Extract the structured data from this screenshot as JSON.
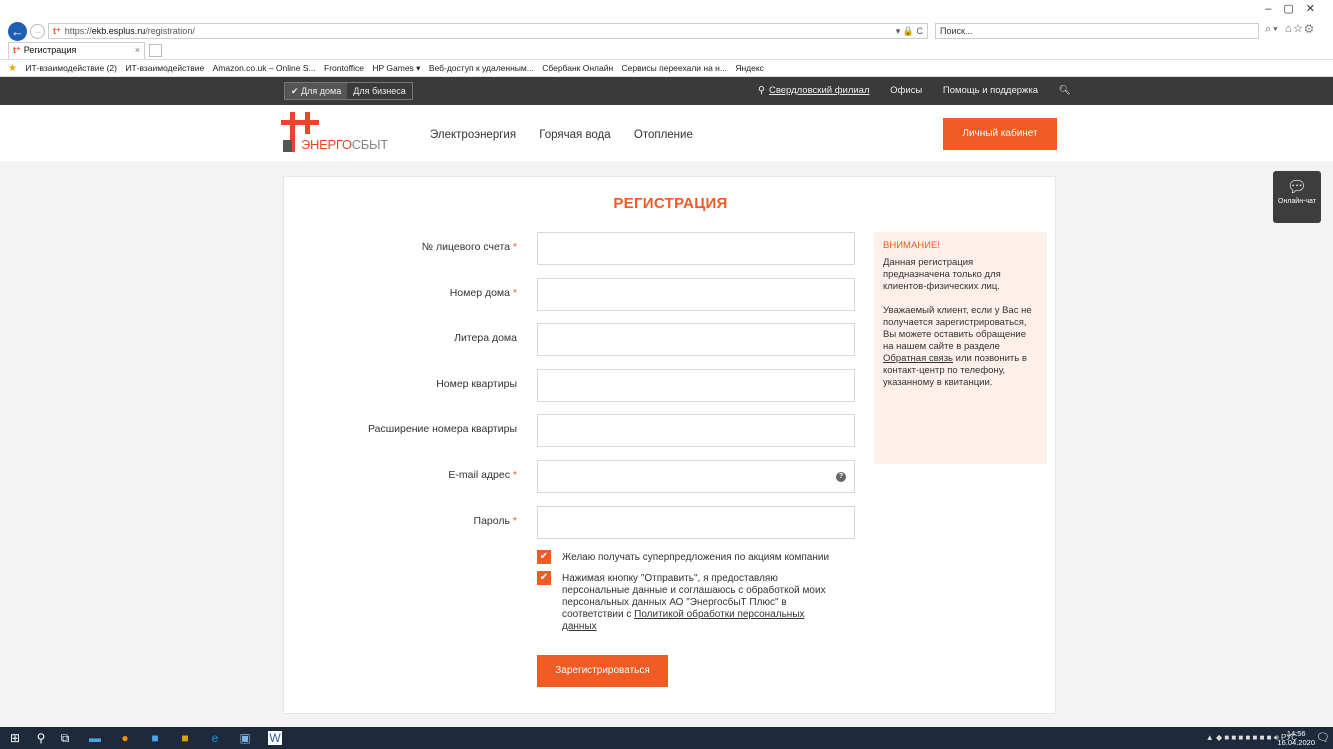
{
  "browser": {
    "url_prefix": "https://",
    "url_host": "ekb.esplus.ru",
    "url_path": "/registration/",
    "url_tools": "▾ 🔒 C",
    "search_placeholder": "Поиск...",
    "tab_title": "Регистрация",
    "favorites": [
      "ИТ-взаимодействие (2)",
      "ИТ-взаимодействие",
      "Amazon.co.uk – Online S...",
      "Frontoffice",
      "HP Games ▾",
      "Веб-доступ к удаленным...",
      "Сбербанк Онлайн",
      "Сервисы переехали на н...",
      "Яндекс"
    ]
  },
  "topstrip": {
    "home_label": "✔ Для дома",
    "business_label": "Для бизнеса",
    "branch": "Свердловский филиал",
    "offices": "Офисы",
    "help": "Помощь и поддержка"
  },
  "header": {
    "logo_brand_a": "ЭНЕРГО",
    "logo_brand_b": "СБЫТ",
    "menu": [
      "Электроэнергия",
      "Горячая вода",
      "Отопление"
    ],
    "cabinet_button": "Личный кабинет"
  },
  "form": {
    "title": "РЕГИСТРАЦИЯ",
    "fields": [
      {
        "label": "№ лицевого счета",
        "required": "*"
      },
      {
        "label": "Номер дома",
        "required": "*"
      },
      {
        "label": "Литера дома",
        "required": ""
      },
      {
        "label": "Номер квартиры",
        "required": ""
      },
      {
        "label": "Расширение номера квартиры",
        "required": ""
      },
      {
        "label": "E-mail адрес",
        "required": "*"
      },
      {
        "label": "Пароль",
        "required": "*"
      }
    ],
    "consent1": "Желаю получать суперпредложения по акциям компании",
    "consent2_text": "Нажимая кнопку \"Отправить\", я предоставляю персональные данные и соглашаюсь с обработкой моих персональных данных АО \"ЭнергосбыТ Плюс\" в соответствии с ",
    "consent2_link": "Политикой обработки персональных данных",
    "submit": "Зарегистрироваться",
    "accent_color": "#f05a23"
  },
  "notice": {
    "title": "ВНИМАНИЕ!",
    "p1": "Данная регистрация предназначена только для клиентов-физических лиц.",
    "p2_a": "Уважаемый клиент, если у Вас не получается зарегистрироваться, Вы можете оставить обращение на нашем сайте в разделе ",
    "p2_link": "Обратная связь",
    "p2_b": " или позвонить в контакт-центр по телефону, указанному в квитанции."
  },
  "chat": {
    "label": "Онлайн-чат"
  },
  "taskbar": {
    "lang": "РУС",
    "time": "14:56",
    "date": "16.04.2020"
  }
}
